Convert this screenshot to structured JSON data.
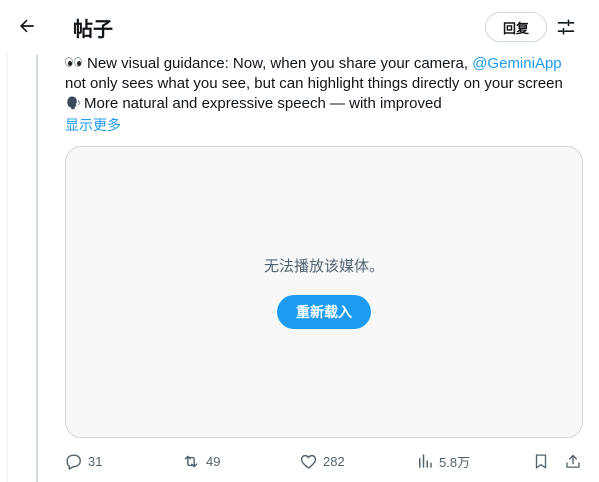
{
  "header": {
    "title": "帖子",
    "reply_label": "回复"
  },
  "post": {
    "line1_text": "New visual guidance: Now, when you share your camera, ",
    "line1_mention": "@GeminiApp",
    "line2_text": "not only sees what you see, but can highlight things directly on your screen",
    "line3_text": "More natural and expressive speech — with improved",
    "show_more": "显示更多"
  },
  "media": {
    "message": "无法播放该媒体。",
    "reload_label": "重新载入"
  },
  "actions": {
    "replies": "31",
    "reposts": "49",
    "likes": "282",
    "views": "5.8万"
  },
  "colors": {
    "accent": "#1d9bf0",
    "secondary_text": "#536471",
    "border": "#cfd9de",
    "media_bg": "#f7f9f9"
  },
  "icons": {
    "back": "arrow-left-icon",
    "settings": "sliders-icon",
    "reply": "speech-bubble-icon",
    "repost": "repost-arrows-icon",
    "like": "heart-icon",
    "views": "bar-chart-icon",
    "bookmark": "bookmark-icon",
    "share": "share-upload-icon"
  }
}
